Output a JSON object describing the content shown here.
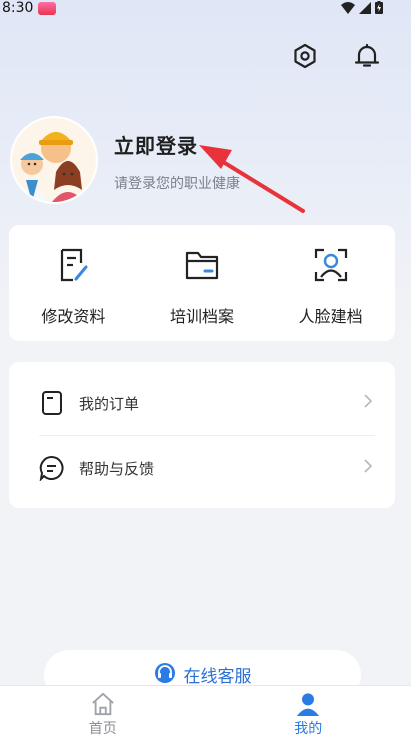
{
  "status_bar": {
    "time": "8:30"
  },
  "header": {
    "settings_icon": "hexagon-settings-icon",
    "bell_icon": "bell-icon"
  },
  "profile": {
    "login_title": "立即登录",
    "login_subtitle": "请登录您的职业健康"
  },
  "quick_actions": [
    {
      "label": "修改资料",
      "icon": "edit-document-icon"
    },
    {
      "label": "培训档案",
      "icon": "folder-icon"
    },
    {
      "label": "人脸建档",
      "icon": "face-scan-icon"
    }
  ],
  "menu": [
    {
      "label": "我的订单",
      "icon": "order-icon"
    },
    {
      "label": "帮助与反馈",
      "icon": "chat-bubble-icon"
    }
  ],
  "service_button": {
    "label": "在线客服",
    "icon": "headset-icon"
  },
  "tabbar": [
    {
      "label": "首页",
      "icon": "home-icon",
      "active": false
    },
    {
      "label": "我的",
      "icon": "user-icon",
      "active": true
    }
  ],
  "colors": {
    "accent": "#2a7be4",
    "arrow": "#e8333a"
  }
}
